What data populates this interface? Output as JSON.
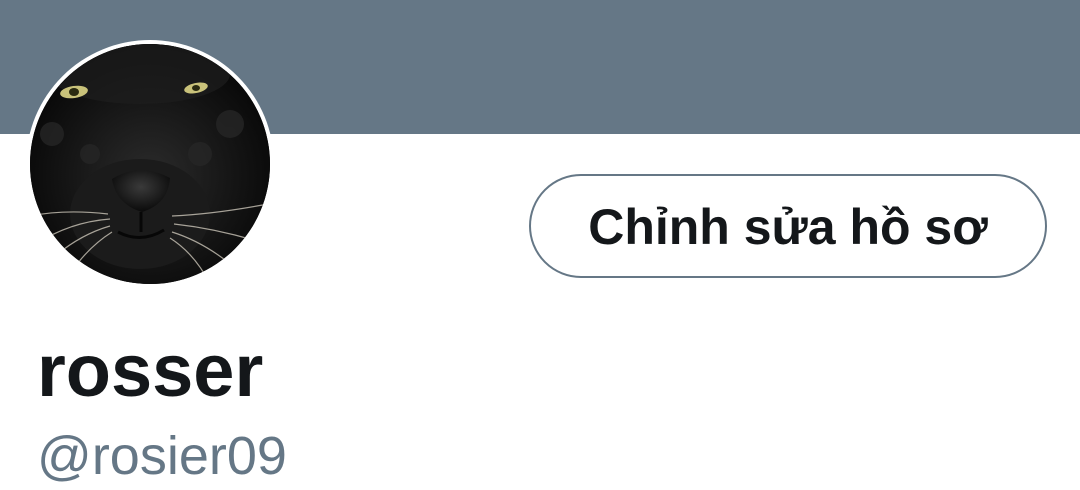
{
  "profile": {
    "banner_color": "#657786",
    "avatar_icon": "black-panther-avatar",
    "edit_button_label": "Chỉnh sửa hồ sơ",
    "display_name": "rosser",
    "username": "@rosier09"
  }
}
